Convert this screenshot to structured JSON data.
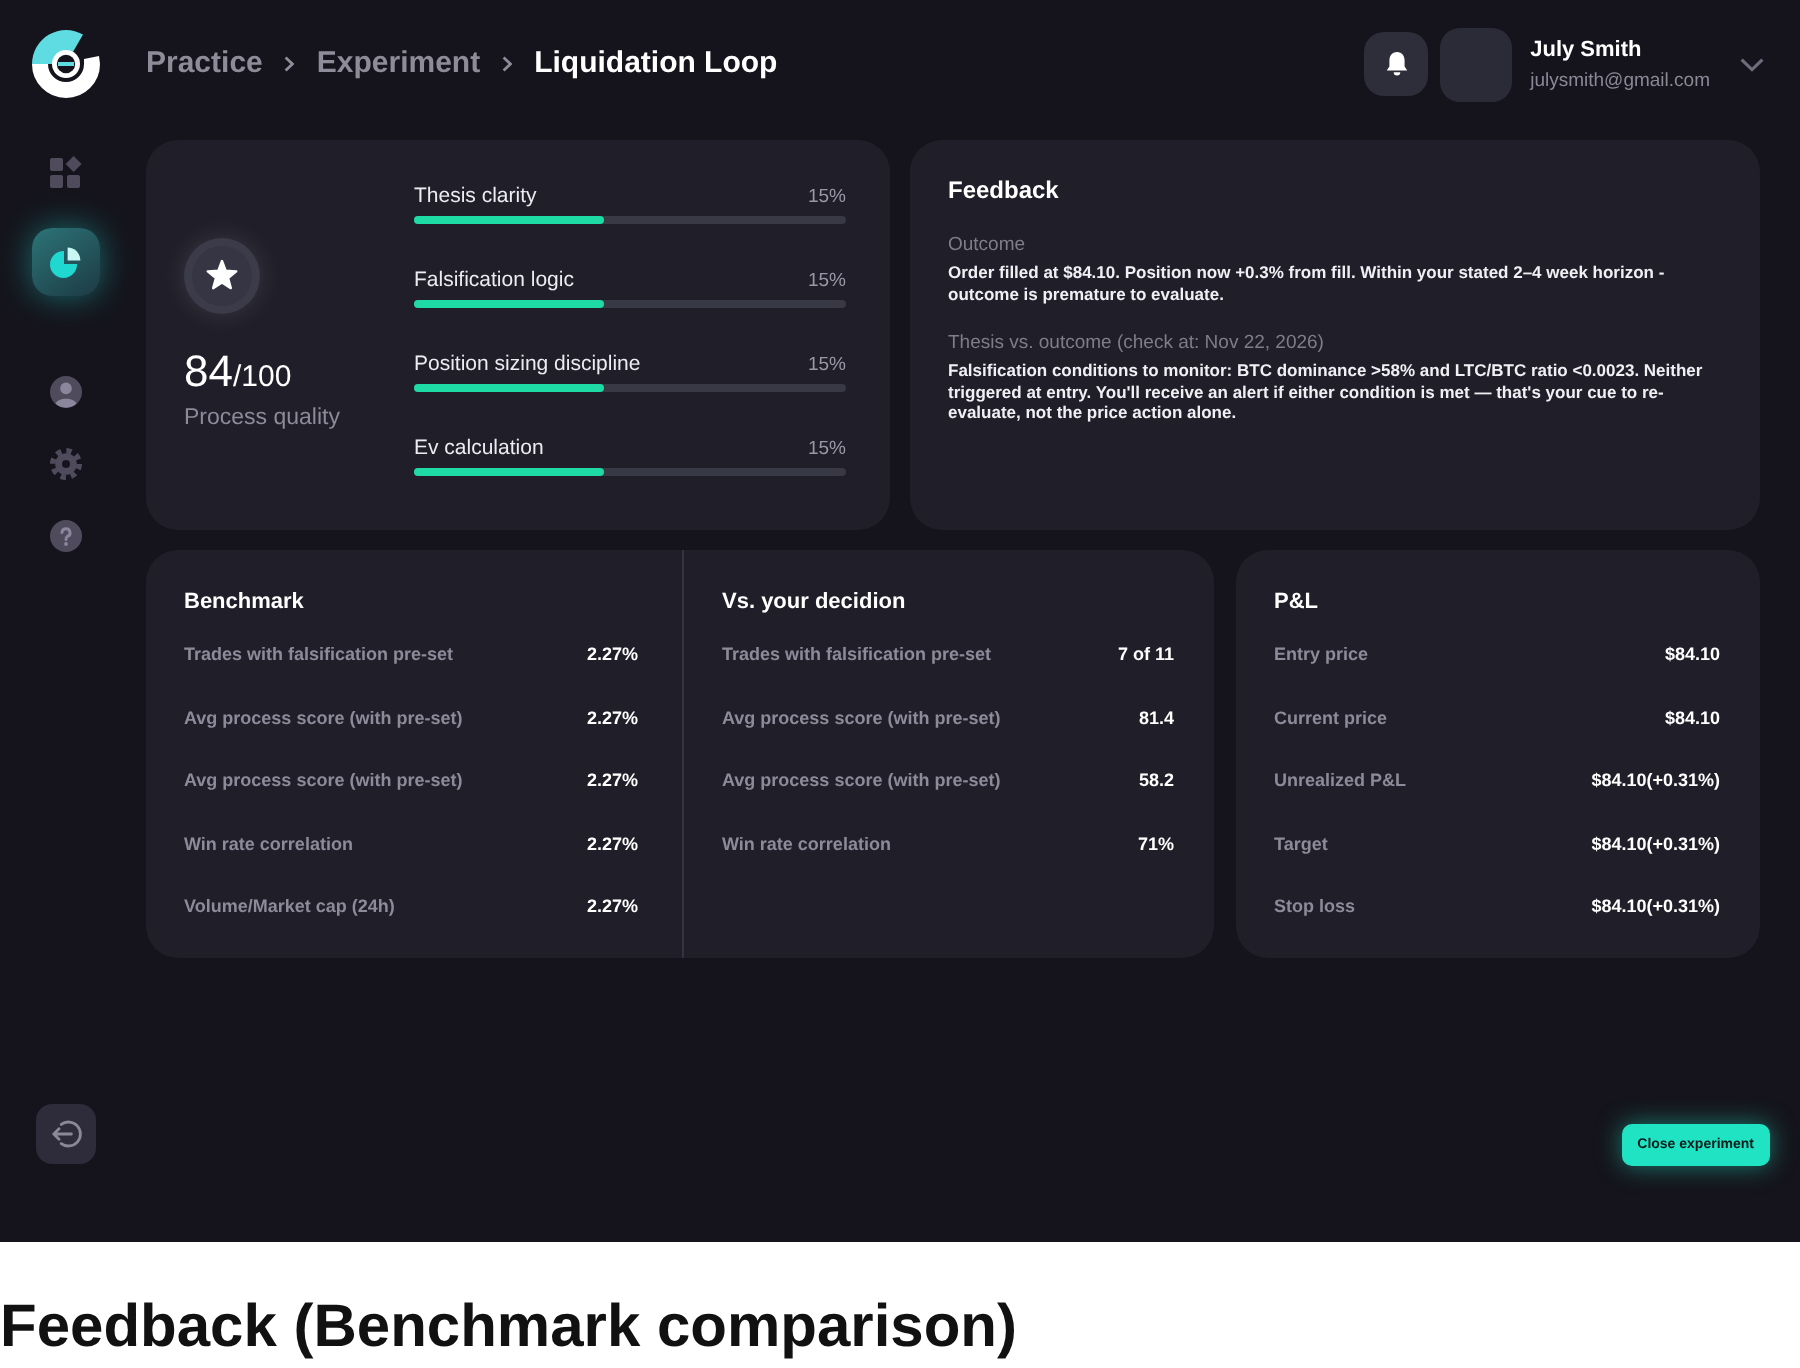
{
  "header": {
    "breadcrumb": [
      {
        "label": "Practice",
        "current": false
      },
      {
        "label": "Experiment",
        "current": false
      },
      {
        "label": "Liquidation Loop",
        "current": true
      }
    ],
    "user": {
      "name": "July Smith",
      "email": "julysmith@gmail.com"
    }
  },
  "sidebar": {
    "items": [
      {
        "selected": false
      },
      {
        "selected": true
      },
      {
        "selected": false
      },
      {
        "selected": false
      },
      {
        "selected": false
      }
    ]
  },
  "process_quality": {
    "score": "84",
    "out_of": "/100",
    "label": "Process quality",
    "criteria": [
      {
        "name": "Thesis clarity",
        "reading": "15%",
        "level": 0.44
      },
      {
        "name": "Falsification logic",
        "reading": "15%",
        "level": 0.44
      },
      {
        "name": "Position sizing discipline",
        "reading": "15%",
        "level": 0.44
      },
      {
        "name": "Ev calculation",
        "reading": "15%",
        "level": 0.44
      }
    ]
  },
  "feedback": {
    "title": "Feedback",
    "sections": [
      {
        "heading": "Outcome",
        "text": "Order filled at $84.10. Position now +0.3% from fill. Within your stated 2–4 week horizon - outcome is premature to evaluate."
      },
      {
        "heading": "Thesis vs. outcome (check at: Nov 22, 2026)",
        "text": "Falsification conditions to monitor: BTC dominance >58% and LTC/BTC ratio <0.0023. Neither triggered at entry. You'll receive an alert if either condition is met — that's your cue to re-evaluate, not the price action alone."
      }
    ]
  },
  "benchmark": {
    "title": "Benchmark",
    "rows": [
      {
        "label": "Trades with falsification pre-set",
        "value": "2.27%"
      },
      {
        "label": "Avg process score (with pre-set)",
        "value": "2.27%"
      },
      {
        "label": "Avg process score (with pre-set)",
        "value": "2.27%"
      },
      {
        "label": "Win rate correlation",
        "value": "2.27%"
      },
      {
        "label": "Volume/Market cap (24h)",
        "value": "2.27%"
      }
    ]
  },
  "your_decision": {
    "title": "Vs. your decidion",
    "rows": [
      {
        "label": "Trades with falsification pre-set",
        "value": "7 of 11"
      },
      {
        "label": "Avg process score (with pre-set)",
        "value": "81.4"
      },
      {
        "label": "Avg process score (with pre-set)",
        "value": "58.2"
      },
      {
        "label": "Win rate correlation",
        "value": "71%"
      }
    ]
  },
  "pnl": {
    "title": "P&L",
    "rows": [
      {
        "label": "Entry price",
        "value": "$84.10"
      },
      {
        "label": "Current price",
        "value": "$84.10"
      },
      {
        "label": "Unrealized P&L",
        "value": "$84.10(+0.31%)"
      },
      {
        "label": "Target",
        "value": "$84.10(+0.31%)"
      },
      {
        "label": "Stop loss",
        "value": "$84.10(+0.31%)"
      }
    ]
  },
  "close_button": "Close experiment",
  "caption": "Feedback (Benchmark comparison)"
}
